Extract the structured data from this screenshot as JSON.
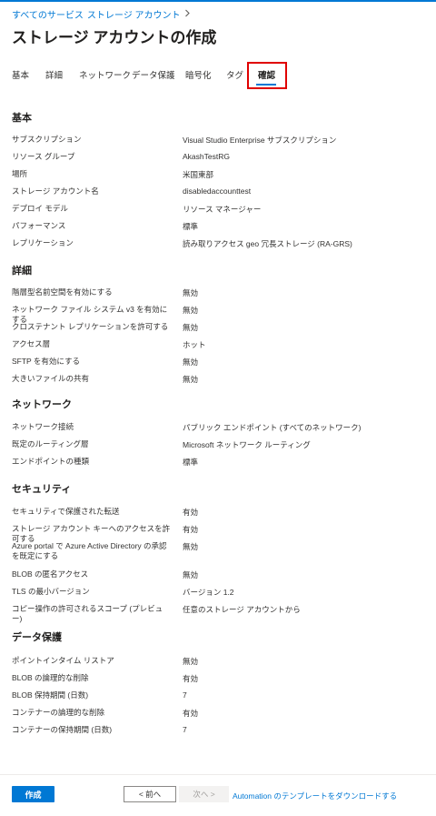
{
  "breadcrumb": {
    "items": [
      "すべてのサービス",
      "ストレージ アカウント"
    ],
    "separator_icon": "chevron-right-icon"
  },
  "page": {
    "title": "ストレージ アカウントの作成",
    "more_label": "···"
  },
  "tabs": [
    {
      "label": "基本",
      "active": false
    },
    {
      "label": "詳細",
      "active": false
    },
    {
      "label": "ネットワーク",
      "active": false
    },
    {
      "label": "データ保護",
      "active": false
    },
    {
      "label": "暗号化",
      "active": false
    },
    {
      "label": "タグ",
      "active": false
    },
    {
      "label": "確認",
      "active": true
    }
  ],
  "highlight_color": "#e00000",
  "accent_color": "#0078d4",
  "sections": [
    {
      "title": "基本",
      "rows": [
        {
          "label": "サブスクリプション",
          "value": "Visual Studio Enterprise サブスクリプション"
        },
        {
          "label": "リソース グループ",
          "value": "AkashTestRG"
        },
        {
          "label": "場所",
          "value": "米国東部"
        },
        {
          "label": "ストレージ アカウント名",
          "value": "disabledaccounttest"
        },
        {
          "label": "デプロイ モデル",
          "value": "リソース マネージャー"
        },
        {
          "label": "パフォーマンス",
          "value": "標準"
        },
        {
          "label": "レプリケーション",
          "value": "読み取りアクセス geo 冗長ストレージ (RA-GRS)"
        }
      ]
    },
    {
      "title": "詳細",
      "rows": [
        {
          "label": "階層型名前空間を有効にする",
          "value": "無効"
        },
        {
          "label": "ネットワーク ファイル システム v3 を有効にする",
          "value": "無効"
        },
        {
          "label": "クロステナント レプリケーションを許可する",
          "value": "無効"
        },
        {
          "label": "アクセス層",
          "value": "ホット"
        },
        {
          "label": "SFTP を有効にする",
          "value": "無効"
        },
        {
          "label": "大きいファイルの共有",
          "value": "無効"
        }
      ]
    },
    {
      "title": "ネットワーク",
      "rows": [
        {
          "label": "ネットワーク接続",
          "value": "パブリック エンドポイント (すべてのネットワーク)"
        },
        {
          "label": "既定のルーティング層",
          "value": "Microsoft ネットワーク ルーティング"
        },
        {
          "label": "エンドポイントの種類",
          "value": "標準"
        }
      ]
    },
    {
      "title": "セキュリティ",
      "rows": [
        {
          "label": "セキュリティで保護された転送",
          "value": "有効"
        },
        {
          "label": "ストレージ アカウント キーへのアクセスを許可する",
          "value": "有効"
        },
        {
          "label": "Azure portal で Azure Active Directory の承認を既定にする",
          "value": "無効"
        },
        {
          "label": "BLOB の匿名アクセス",
          "value": "無効"
        },
        {
          "label": "TLS の最小バージョン",
          "value": "バージョン 1.2"
        },
        {
          "label": "コピー操作の許可されるスコープ (プレビュー)",
          "value": "任意のストレージ アカウントから"
        }
      ]
    },
    {
      "title": "データ保護",
      "rows": [
        {
          "label": "ポイントインタイム リストア",
          "value": "無効"
        },
        {
          "label": "BLOB の論理的な削除",
          "value": "有効"
        },
        {
          "label": "BLOB 保持期間 (日数)",
          "value": "7"
        },
        {
          "label": "コンテナーの論理的な削除",
          "value": "有効"
        },
        {
          "label": "コンテナーの保持期間 (日数)",
          "value": "7"
        }
      ]
    }
  ],
  "footer": {
    "create_label": "作成",
    "prev_label": "< 前へ",
    "next_label": "次へ >",
    "download_link": "Automation のテンプレートをダウンロードする"
  }
}
